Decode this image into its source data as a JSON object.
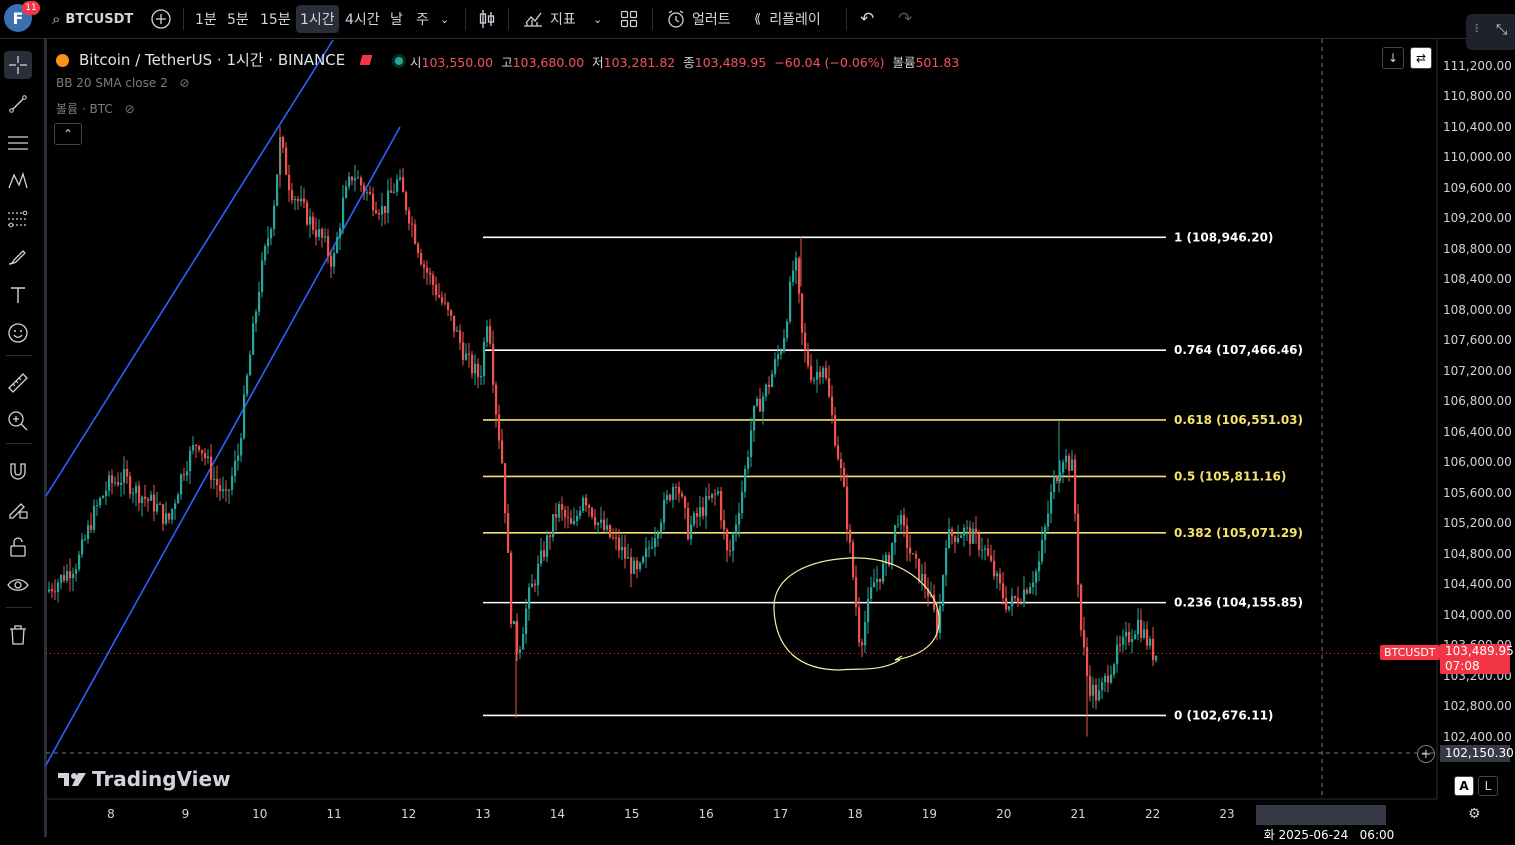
{
  "topbar": {
    "avatar_letter": "F",
    "notification_count": "11",
    "symbol": "BTCUSDT",
    "intervals": [
      "1분",
      "5분",
      "15분",
      "1시간",
      "4시간",
      "날",
      "주"
    ],
    "active_interval": "1시간",
    "indicators_label": "지표",
    "alert_label": "얼러트",
    "replay_label": "리플레이"
  },
  "legend": {
    "title": "Bitcoin / TetherUS · 1시간 · BINANCE",
    "open_label": "시",
    "open": "103,550.00",
    "high_label": "고",
    "high": "103,680.00",
    "low_label": "저",
    "low": "103,281.82",
    "close_label": "종",
    "close": "103,489.95",
    "change": "−60.04 (−0.06%)",
    "volume_label": "볼륨",
    "volume": "501.83",
    "indicator_bb": "BB 20 SMA close 2",
    "indicator_volume": "볼륨 · BTC"
  },
  "price_axis": {
    "labels": [
      "111,200.00",
      "110,800.00",
      "110,400.00",
      "110,000.00",
      "109,600.00",
      "109,200.00",
      "108,800.00",
      "108,400.00",
      "108,000.00",
      "107,600.00",
      "107,200.00",
      "106,800.00",
      "106,400.00",
      "106,000.00",
      "105,600.00",
      "105,200.00",
      "104,800.00",
      "104,400.00",
      "104,000.00",
      "103,600.00",
      "103,200.00",
      "102,800.00",
      "102,400.00"
    ],
    "current_symbol": "BTCUSDT",
    "current_price": "103,489.95",
    "countdown": "07:08",
    "crosshair_price": "102,150.30"
  },
  "time_axis": {
    "labels": [
      "8",
      "9",
      "10",
      "11",
      "12",
      "13",
      "14",
      "15",
      "16",
      "17",
      "18",
      "19",
      "20",
      "21",
      "22",
      "23"
    ],
    "crosshair_time": "화 2025-06-24   06:00"
  },
  "fib_levels": [
    {
      "ratio": "1",
      "price": "108,946.20",
      "label": "1 (108,946.20)",
      "color": "#ffffff"
    },
    {
      "ratio": "0.764",
      "price": "107,466.46",
      "label": "0.764 (107,466.46)",
      "color": "#ffffff"
    },
    {
      "ratio": "0.618",
      "price": "106,551.03",
      "label": "0.618 (106,551.03)",
      "color": "#f5e26b"
    },
    {
      "ratio": "0.5",
      "price": "105,811.16",
      "label": "0.5 (105,811.16)",
      "color": "#f5e26b"
    },
    {
      "ratio": "0.382",
      "price": "105,071.29",
      "label": "0.382 (105,071.29)",
      "color": "#f5e26b"
    },
    {
      "ratio": "0.236",
      "price": "104,155.85",
      "label": "0.236 (104,155.85)",
      "color": "#ffffff"
    },
    {
      "ratio": "0",
      "price": "102,676.11",
      "label": "0 (102,676.11)",
      "color": "#ffffff"
    }
  ],
  "brand": {
    "logo_text": "TradingView"
  },
  "scale_buttons": {
    "auto": "A",
    "log": "L"
  },
  "colors": {
    "up": "#26a69a",
    "down": "#ef5350",
    "channel": "#2962ff",
    "fib_yellow": "#f5e26b",
    "circle": "#f5f0a8"
  }
}
